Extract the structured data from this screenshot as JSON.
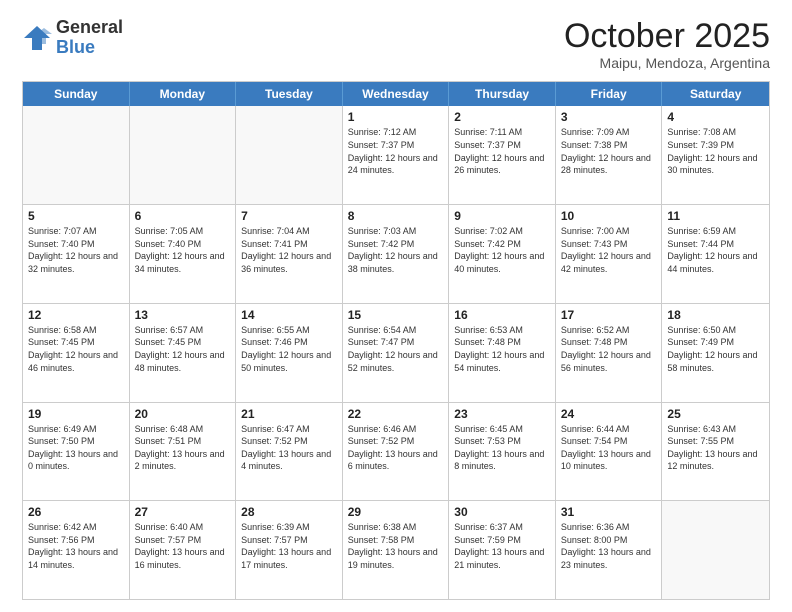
{
  "logo": {
    "general": "General",
    "blue": "Blue"
  },
  "title": {
    "month": "October 2025",
    "location": "Maipu, Mendoza, Argentina"
  },
  "header_days": [
    "Sunday",
    "Monday",
    "Tuesday",
    "Wednesday",
    "Thursday",
    "Friday",
    "Saturday"
  ],
  "weeks": [
    [
      {
        "day": "",
        "info": ""
      },
      {
        "day": "",
        "info": ""
      },
      {
        "day": "",
        "info": ""
      },
      {
        "day": "1",
        "info": "Sunrise: 7:12 AM\nSunset: 7:37 PM\nDaylight: 12 hours\nand 24 minutes."
      },
      {
        "day": "2",
        "info": "Sunrise: 7:11 AM\nSunset: 7:37 PM\nDaylight: 12 hours\nand 26 minutes."
      },
      {
        "day": "3",
        "info": "Sunrise: 7:09 AM\nSunset: 7:38 PM\nDaylight: 12 hours\nand 28 minutes."
      },
      {
        "day": "4",
        "info": "Sunrise: 7:08 AM\nSunset: 7:39 PM\nDaylight: 12 hours\nand 30 minutes."
      }
    ],
    [
      {
        "day": "5",
        "info": "Sunrise: 7:07 AM\nSunset: 7:40 PM\nDaylight: 12 hours\nand 32 minutes."
      },
      {
        "day": "6",
        "info": "Sunrise: 7:05 AM\nSunset: 7:40 PM\nDaylight: 12 hours\nand 34 minutes."
      },
      {
        "day": "7",
        "info": "Sunrise: 7:04 AM\nSunset: 7:41 PM\nDaylight: 12 hours\nand 36 minutes."
      },
      {
        "day": "8",
        "info": "Sunrise: 7:03 AM\nSunset: 7:42 PM\nDaylight: 12 hours\nand 38 minutes."
      },
      {
        "day": "9",
        "info": "Sunrise: 7:02 AM\nSunset: 7:42 PM\nDaylight: 12 hours\nand 40 minutes."
      },
      {
        "day": "10",
        "info": "Sunrise: 7:00 AM\nSunset: 7:43 PM\nDaylight: 12 hours\nand 42 minutes."
      },
      {
        "day": "11",
        "info": "Sunrise: 6:59 AM\nSunset: 7:44 PM\nDaylight: 12 hours\nand 44 minutes."
      }
    ],
    [
      {
        "day": "12",
        "info": "Sunrise: 6:58 AM\nSunset: 7:45 PM\nDaylight: 12 hours\nand 46 minutes."
      },
      {
        "day": "13",
        "info": "Sunrise: 6:57 AM\nSunset: 7:45 PM\nDaylight: 12 hours\nand 48 minutes."
      },
      {
        "day": "14",
        "info": "Sunrise: 6:55 AM\nSunset: 7:46 PM\nDaylight: 12 hours\nand 50 minutes."
      },
      {
        "day": "15",
        "info": "Sunrise: 6:54 AM\nSunset: 7:47 PM\nDaylight: 12 hours\nand 52 minutes."
      },
      {
        "day": "16",
        "info": "Sunrise: 6:53 AM\nSunset: 7:48 PM\nDaylight: 12 hours\nand 54 minutes."
      },
      {
        "day": "17",
        "info": "Sunrise: 6:52 AM\nSunset: 7:48 PM\nDaylight: 12 hours\nand 56 minutes."
      },
      {
        "day": "18",
        "info": "Sunrise: 6:50 AM\nSunset: 7:49 PM\nDaylight: 12 hours\nand 58 minutes."
      }
    ],
    [
      {
        "day": "19",
        "info": "Sunrise: 6:49 AM\nSunset: 7:50 PM\nDaylight: 13 hours\nand 0 minutes."
      },
      {
        "day": "20",
        "info": "Sunrise: 6:48 AM\nSunset: 7:51 PM\nDaylight: 13 hours\nand 2 minutes."
      },
      {
        "day": "21",
        "info": "Sunrise: 6:47 AM\nSunset: 7:52 PM\nDaylight: 13 hours\nand 4 minutes."
      },
      {
        "day": "22",
        "info": "Sunrise: 6:46 AM\nSunset: 7:52 PM\nDaylight: 13 hours\nand 6 minutes."
      },
      {
        "day": "23",
        "info": "Sunrise: 6:45 AM\nSunset: 7:53 PM\nDaylight: 13 hours\nand 8 minutes."
      },
      {
        "day": "24",
        "info": "Sunrise: 6:44 AM\nSunset: 7:54 PM\nDaylight: 13 hours\nand 10 minutes."
      },
      {
        "day": "25",
        "info": "Sunrise: 6:43 AM\nSunset: 7:55 PM\nDaylight: 13 hours\nand 12 minutes."
      }
    ],
    [
      {
        "day": "26",
        "info": "Sunrise: 6:42 AM\nSunset: 7:56 PM\nDaylight: 13 hours\nand 14 minutes."
      },
      {
        "day": "27",
        "info": "Sunrise: 6:40 AM\nSunset: 7:57 PM\nDaylight: 13 hours\nand 16 minutes."
      },
      {
        "day": "28",
        "info": "Sunrise: 6:39 AM\nSunset: 7:57 PM\nDaylight: 13 hours\nand 17 minutes."
      },
      {
        "day": "29",
        "info": "Sunrise: 6:38 AM\nSunset: 7:58 PM\nDaylight: 13 hours\nand 19 minutes."
      },
      {
        "day": "30",
        "info": "Sunrise: 6:37 AM\nSunset: 7:59 PM\nDaylight: 13 hours\nand 21 minutes."
      },
      {
        "day": "31",
        "info": "Sunrise: 6:36 AM\nSunset: 8:00 PM\nDaylight: 13 hours\nand 23 minutes."
      },
      {
        "day": "",
        "info": ""
      }
    ]
  ]
}
